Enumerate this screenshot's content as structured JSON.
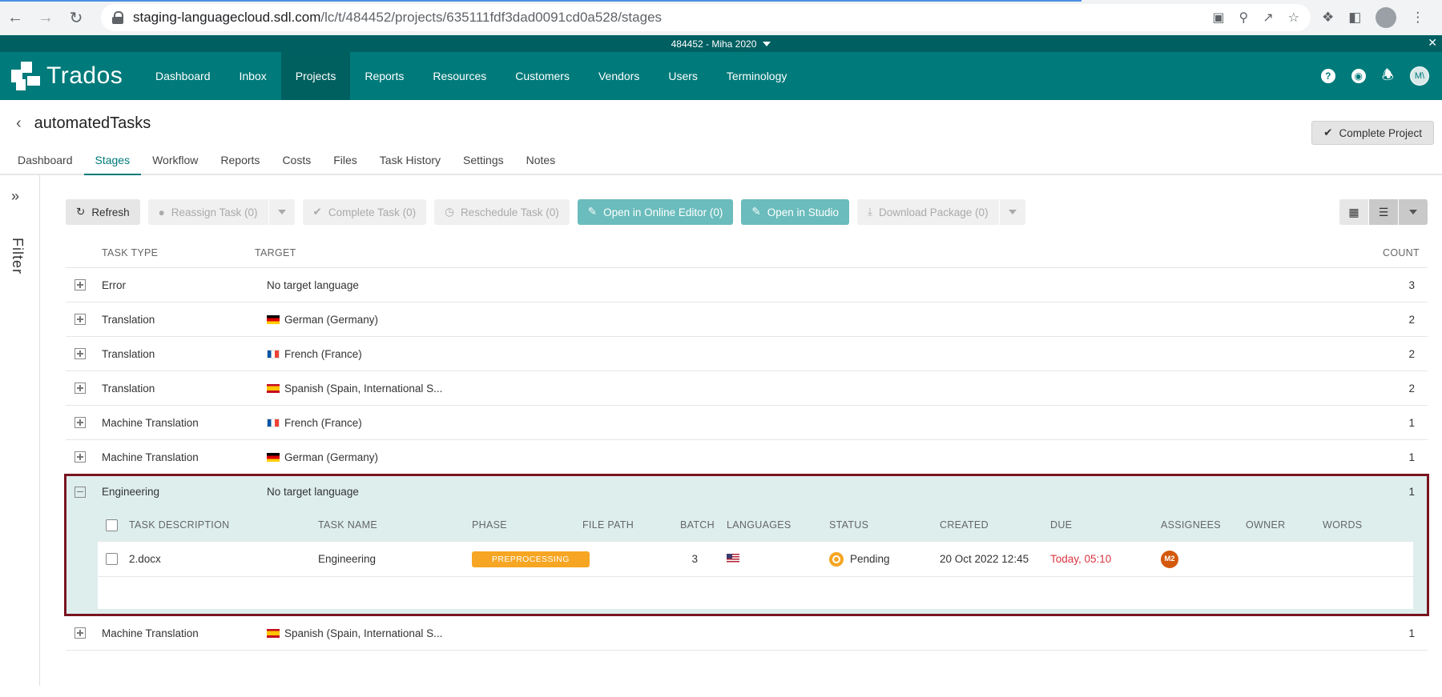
{
  "browser": {
    "url_host": "staging-languagecloud.sdl.com",
    "url_path": "/lc/t/484452/projects/635111fdf3dad0091cd0a528/stages"
  },
  "tenant": {
    "label": "484452 - Miha 2020"
  },
  "nav": {
    "logo": "Trados",
    "items": [
      "Dashboard",
      "Inbox",
      "Projects",
      "Reports",
      "Resources",
      "Customers",
      "Vendors",
      "Users",
      "Terminology"
    ],
    "active": "Projects",
    "avatar": "M\\"
  },
  "project": {
    "title": "automatedTasks",
    "complete_label": "Complete Project"
  },
  "tabs": {
    "items": [
      "Dashboard",
      "Stages",
      "Workflow",
      "Reports",
      "Costs",
      "Files",
      "Task History",
      "Settings",
      "Notes"
    ],
    "active": "Stages"
  },
  "filter": {
    "label": "Filter"
  },
  "toolbar": {
    "refresh": "Refresh",
    "reassign": "Reassign Task (0)",
    "complete": "Complete Task (0)",
    "reschedule": "Reschedule Task (0)",
    "open_online": "Open in Online Editor (0)",
    "open_studio": "Open in Studio",
    "download": "Download Package (0)"
  },
  "table": {
    "headers": {
      "type": "TASK TYPE",
      "target": "TARGET",
      "count": "COUNT"
    },
    "rows": [
      {
        "type": "Error",
        "target": "No target language",
        "flag": "",
        "count": "3"
      },
      {
        "type": "Translation",
        "target": "German (Germany)",
        "flag": "de",
        "count": "2"
      },
      {
        "type": "Translation",
        "target": "French (France)",
        "flag": "fr",
        "count": "2"
      },
      {
        "type": "Translation",
        "target": "Spanish (Spain, International S...",
        "flag": "es",
        "count": "2"
      },
      {
        "type": "Machine Translation",
        "target": "French (France)",
        "flag": "fr",
        "count": "1"
      },
      {
        "type": "Machine Translation",
        "target": "German (Germany)",
        "flag": "de",
        "count": "1"
      }
    ],
    "expanded": {
      "type": "Engineering",
      "target": "No target language",
      "count": "1"
    },
    "last_row": {
      "type": "Machine Translation",
      "target": "Spanish (Spain, International S...",
      "flag": "es",
      "count": "1"
    }
  },
  "subtable": {
    "headers": {
      "desc": "TASK DESCRIPTION",
      "name": "TASK NAME",
      "phase": "PHASE",
      "path": "FILE PATH",
      "batch": "BATCH",
      "languages": "LANGUAGES",
      "status": "STATUS",
      "created": "CREATED",
      "due": "DUE",
      "assignees": "ASSIGNEES",
      "owner": "OWNER",
      "words": "WORDS"
    },
    "row": {
      "desc": "2.docx",
      "name": "Engineering",
      "phase": "PREPROCESSING",
      "path": "",
      "batch": "3",
      "language_flag": "us",
      "status": "Pending",
      "created": "20 Oct 2022 12:45",
      "due": "Today, 05:10",
      "assignee": "M2",
      "owner": "",
      "words": ""
    }
  },
  "colors": {
    "brand": "#007a7a",
    "highlight_outline": "#7a1420",
    "phase": "#f6a623",
    "due": "#d9343f"
  }
}
